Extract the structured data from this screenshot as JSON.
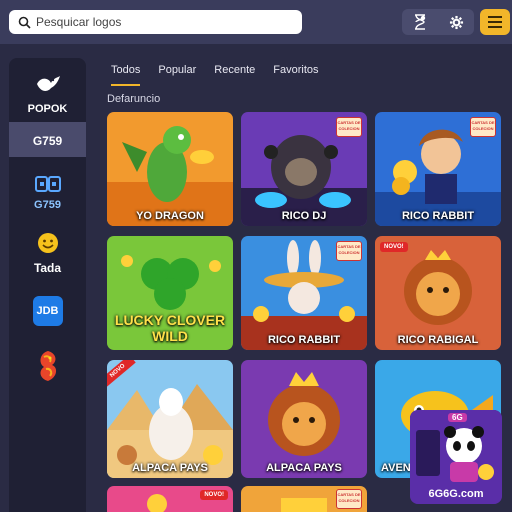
{
  "search": {
    "placeholder": "Pesquicar logos"
  },
  "toolbar": {
    "history_icon": "hourglass-icon",
    "settings_icon": "gear-icon",
    "menu_icon": "hamburger-icon"
  },
  "colors": {
    "accent": "#f2b62a",
    "topbar": "#3a3c5c",
    "sidebar": "#1f2034",
    "background": "#2a2b44"
  },
  "sidebar": {
    "providers": [
      {
        "label": "POPOK",
        "icon": "bird-icon"
      },
      {
        "label": "G759",
        "icon": "g759-logo",
        "active": true
      },
      {
        "label": "G759",
        "icon": "g759-tile-logo"
      },
      {
        "label": "Tada",
        "icon": "smiley-icon"
      },
      {
        "label": "JDB",
        "icon": "jdb-logo"
      },
      {
        "label": "",
        "icon": "dragon-logo"
      }
    ]
  },
  "tabs": [
    "Todos",
    "Popular",
    "Recente",
    "Favoritos"
  ],
  "section_title": "Defaruncio",
  "badges": {
    "cartas_de_colecion": "CARTAS DE COLECION",
    "nuevo": "NOVO!",
    "nuevo_corner": "NOVO"
  },
  "games": [
    {
      "title": "YO DRAGON",
      "icon": "dragon-art"
    },
    {
      "title": "RICO DJ",
      "icon": "gorilla-dj-art"
    },
    {
      "title": "RICO RABBIT",
      "icon": "coin-man-art"
    },
    {
      "title": "LUCKY CLOVER WILD",
      "icon": "clover-art"
    },
    {
      "title": "RICO RABBIT",
      "icon": "rabbit-art"
    },
    {
      "title": "RICO RABIGAL",
      "icon": "lion-art"
    },
    {
      "title": "ALPACA PAYS",
      "icon": "alpaca-art"
    },
    {
      "title": "ALPACA PAYS",
      "icon": "lion-king-art"
    },
    {
      "title": "AVEN",
      "icon": "fish-art"
    }
  ],
  "promo": {
    "label": "6G6G.com",
    "badge": "6G",
    "icon": "panda-art"
  }
}
